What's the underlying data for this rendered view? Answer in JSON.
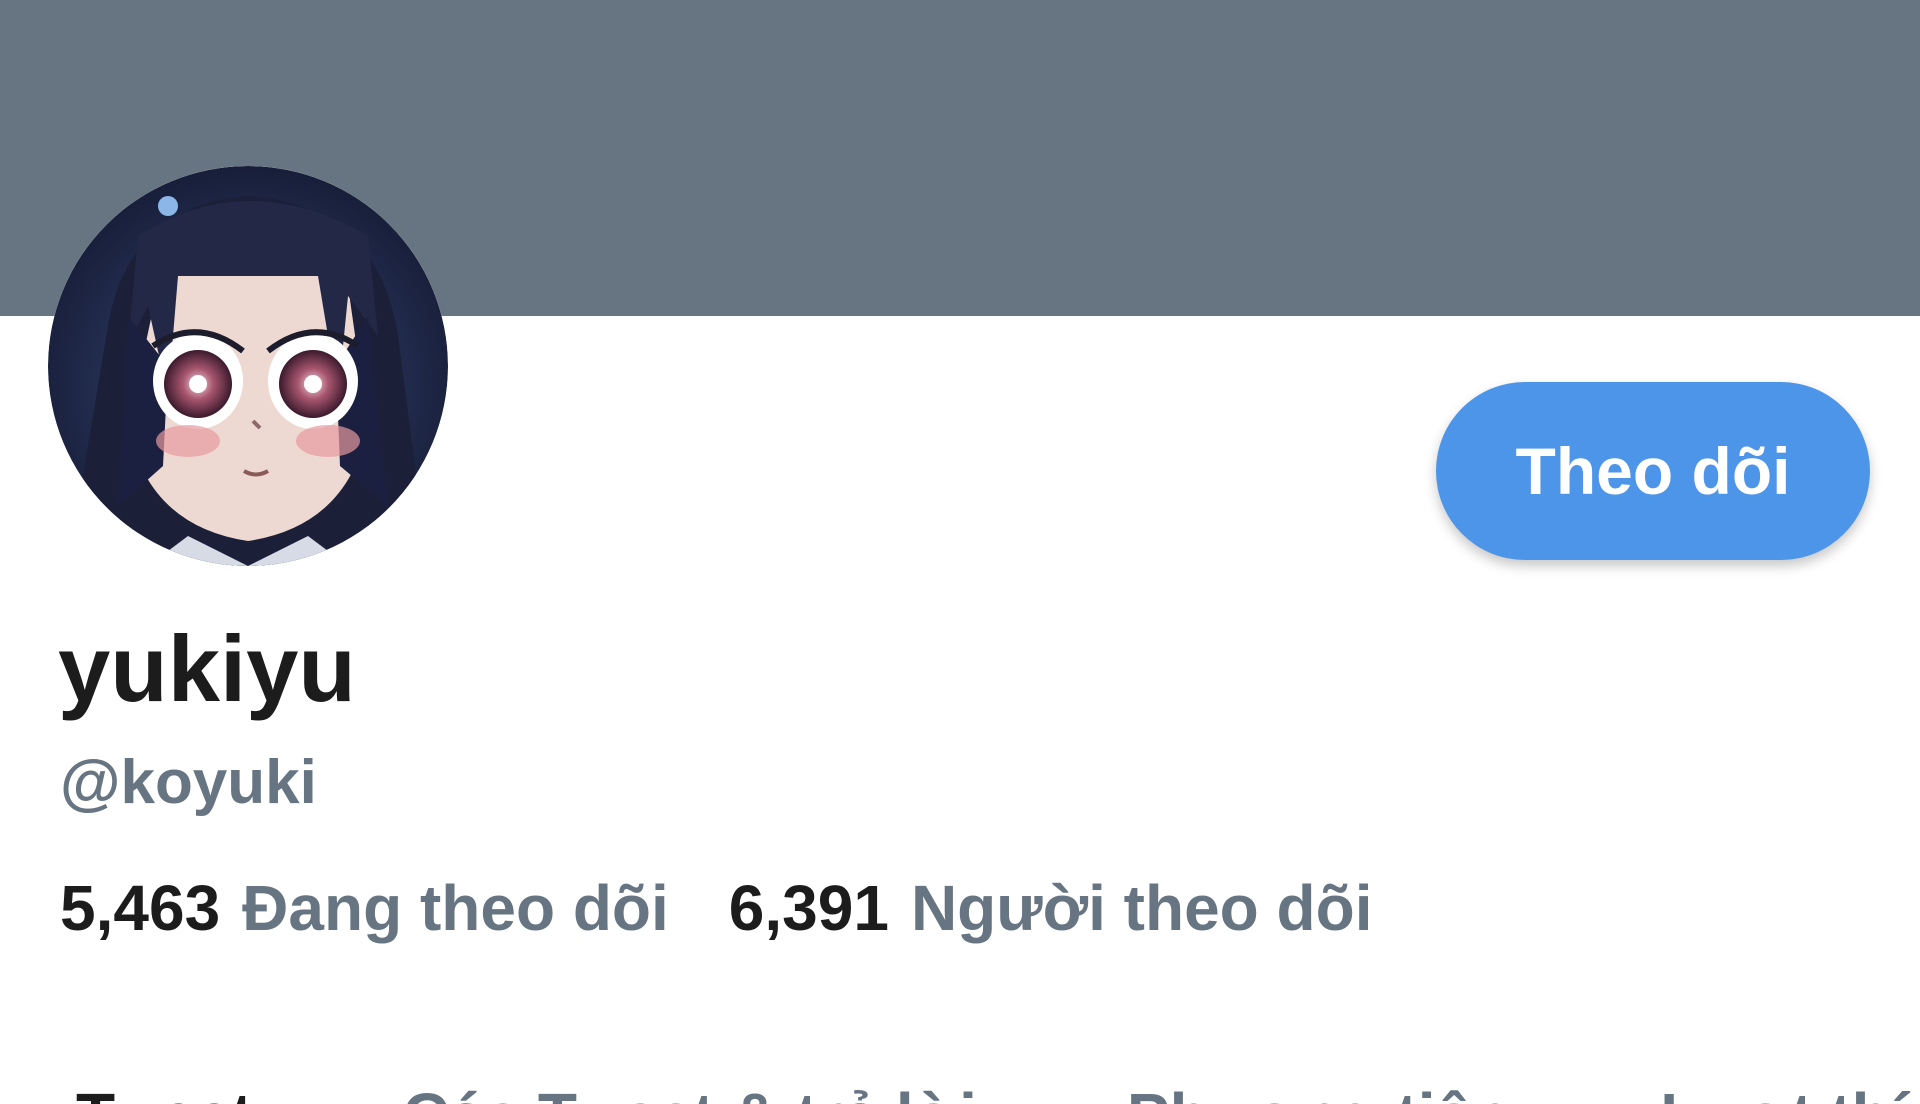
{
  "profile": {
    "display_name": "yukiyu",
    "handle": "@koyuki",
    "follow_button_label": "Theo dõi",
    "following_count": "5,463",
    "following_label": "Đang theo dõi",
    "followers_count": "6,391",
    "followers_label": "Người theo dõi"
  },
  "tabs": [
    {
      "label": "Tweet",
      "active": true
    },
    {
      "label": "Các Tweet & trả lời",
      "active": false
    },
    {
      "label": "Phương tiện",
      "active": false
    },
    {
      "label": "Lượt thích",
      "active": false
    }
  ],
  "colors": {
    "banner": "#677583",
    "accent": "#4d95e8",
    "text_primary": "#1c1c1c",
    "text_secondary": "#677583"
  },
  "icons": {
    "avatar": "anime-girl-portrait"
  }
}
